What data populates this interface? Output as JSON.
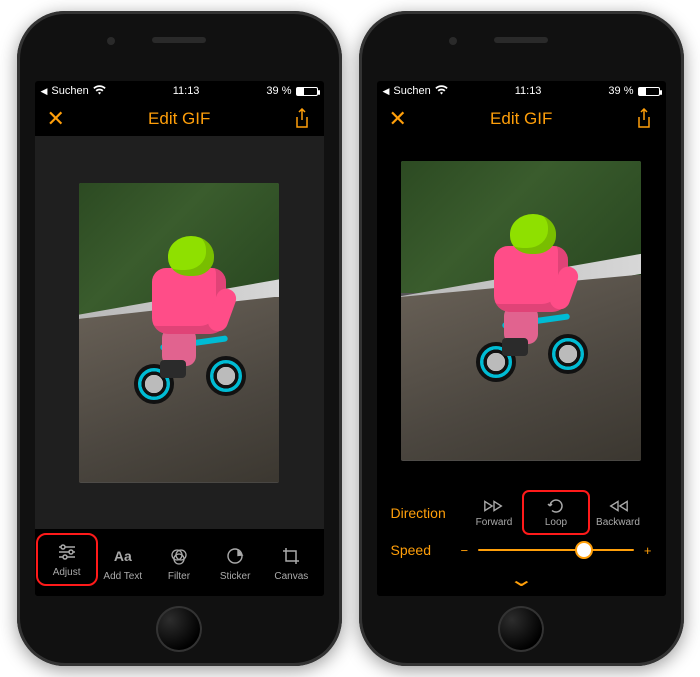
{
  "status": {
    "back_app": "Suchen",
    "time": "11:13",
    "battery_pct": "39 %"
  },
  "header": {
    "title": "Edit GIF"
  },
  "toolbar": {
    "items": [
      {
        "label": "Adjust"
      },
      {
        "label": "Add Text"
      },
      {
        "label": "Filter"
      },
      {
        "label": "Sticker"
      },
      {
        "label": "Canvas"
      }
    ]
  },
  "adjust_panel": {
    "direction_label": "Direction",
    "direction_options": {
      "forward": "Forward",
      "loop": "Loop",
      "backward": "Backward"
    },
    "speed_label": "Speed",
    "speed_minus": "−",
    "speed_plus": "+"
  },
  "accent_color": "#ff9f0a",
  "highlight_color": "#ff1a1a"
}
